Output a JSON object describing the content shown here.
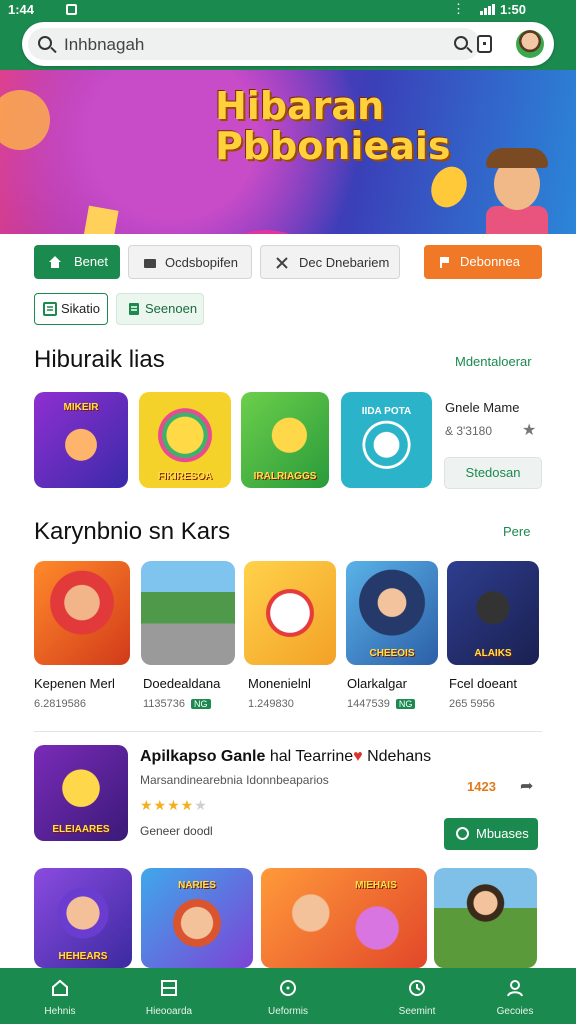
{
  "status_bar": {
    "time_left": "1:44",
    "time_right": "1:50",
    "dots": "⋮"
  },
  "search": {
    "placeholder": "Inhbnagah"
  },
  "banner": {
    "title_line1": "Hibaran",
    "title_line2": "Pbbonieais"
  },
  "chips": {
    "home": "Benet",
    "b": "Ocdsbopifen",
    "c": "Dec Dnebariem",
    "d": "Debonnea",
    "e": "Sikatio",
    "f": "Seenoen"
  },
  "section1": {
    "title": "Hiburaik lias",
    "link": "Mdentaloerar",
    "tiles": [
      {
        "label": "MIKEIR"
      },
      {
        "label": "FIKIRESOA"
      },
      {
        "label": "IRALRIAGGS"
      },
      {
        "label": "IIDA POTA"
      }
    ],
    "info": {
      "name": "Gnele Mame",
      "count": "& 3'3180",
      "button": "Stedosan"
    }
  },
  "section2": {
    "title": "Karynbnio sn Kars",
    "link": "Pere",
    "games": [
      {
        "name": "Kepenen Merl",
        "meta": "6.2819586",
        "tag": ""
      },
      {
        "name": "Doedealdana",
        "meta": "1135736",
        "tag": "NG"
      },
      {
        "name": "Monenielnl",
        "meta": "1.249830",
        "tag": ""
      },
      {
        "name": "Olarkalgar",
        "meta": "1447539",
        "tag": "NG"
      },
      {
        "name": "Fcel doeant",
        "meta": "265 5956",
        "tag": ""
      }
    ],
    "tiles": [
      {
        "label": ""
      },
      {
        "label": ""
      },
      {
        "label": ""
      },
      {
        "label": "CHEEOIS"
      },
      {
        "label": "ALAIKS"
      }
    ]
  },
  "featured": {
    "title": "Apilkapso Ganle",
    "title_rest": " hal Tearrine",
    "title_tail": " Ndehans",
    "subtitle": "Marsandinearebnia Idonnbeaparios",
    "rating": 4,
    "developer": "Geneer doodl",
    "price": "1423",
    "button": "Mbuases",
    "tile_label": "ELEIAARES"
  },
  "bottom_row": {
    "tiles": [
      {
        "label": "HEHEARS"
      },
      {
        "label": "NARIES"
      },
      {
        "label": "MIEHAIS"
      },
      {
        "label": ""
      },
      {
        "label": ""
      }
    ]
  },
  "bottom_nav": [
    {
      "label": "Hehnis"
    },
    {
      "label": "Hieooarda"
    },
    {
      "label": "Ueformis"
    },
    {
      "label": "Seemint"
    },
    {
      "label": "Gecoies"
    }
  ],
  "colors": {
    "brand": "#1b8a4e",
    "accent_orange": "#f07826"
  }
}
